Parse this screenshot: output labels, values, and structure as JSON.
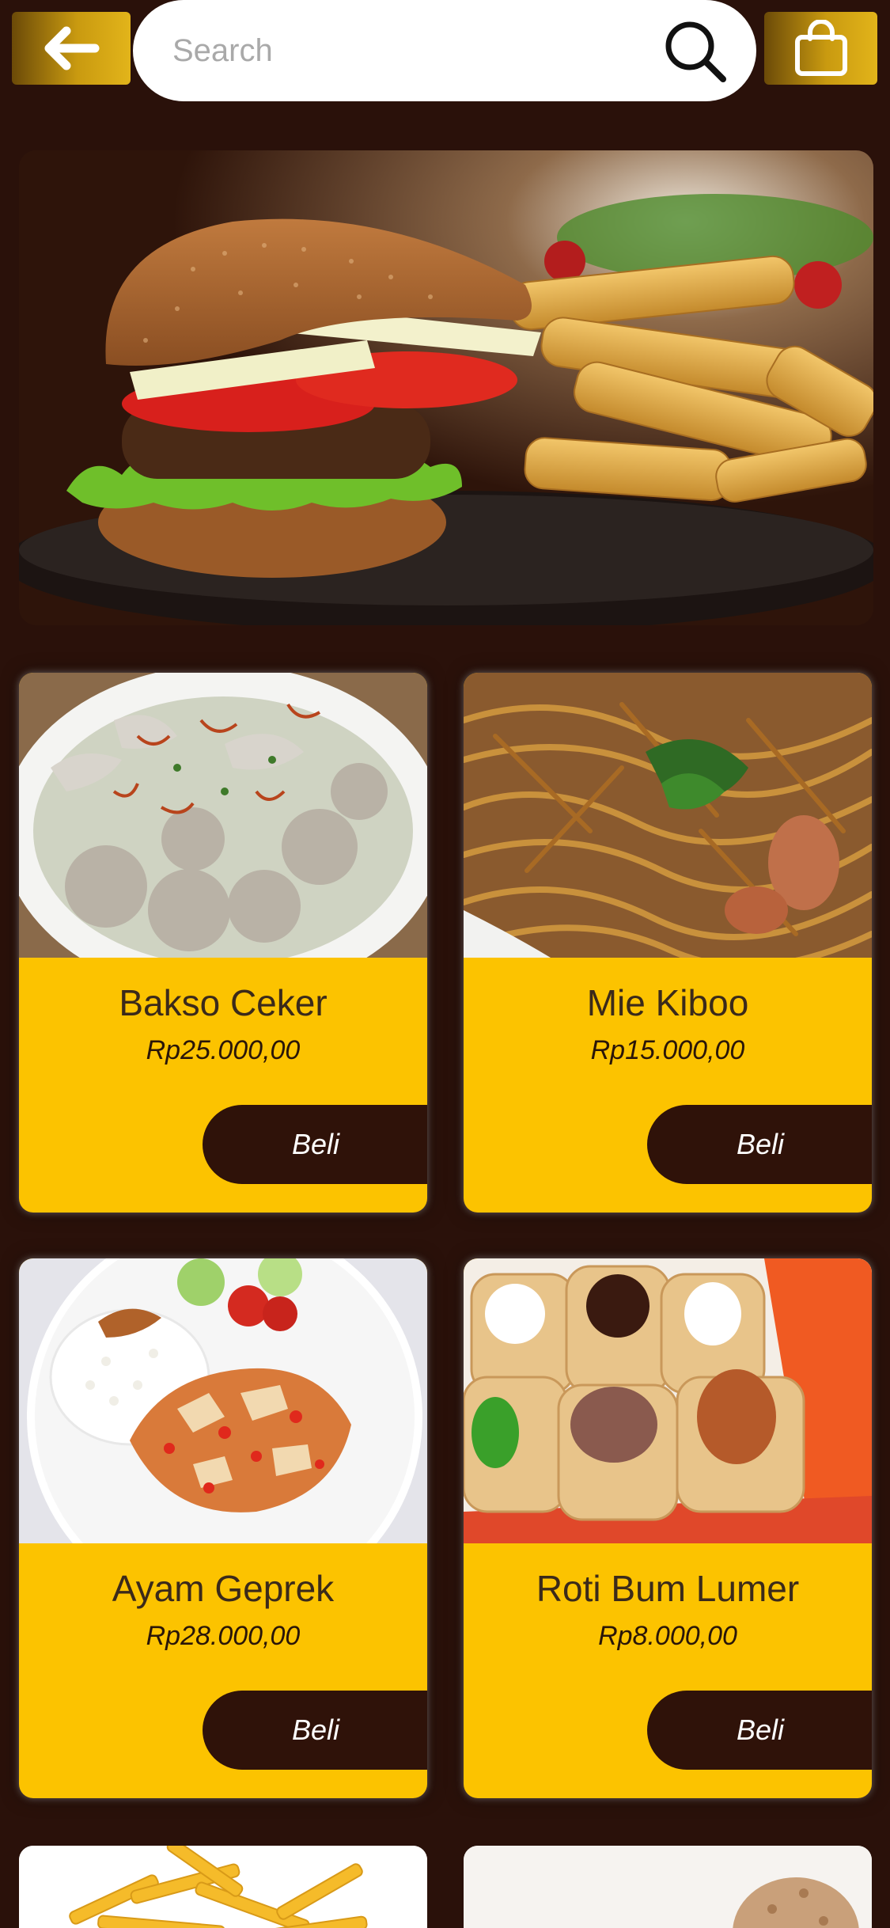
{
  "header": {
    "search_placeholder": "Search",
    "back_icon": "arrow-left-icon",
    "search_icon": "search-icon",
    "cart_icon": "shopping-bag-icon"
  },
  "banner": {
    "image": "burger-and-fries-photo"
  },
  "products": [
    {
      "name": "Bakso Ceker",
      "price": "Rp25.000,00",
      "buy_label": "Beli",
      "image": "bakso-ceker-photo"
    },
    {
      "name": "Mie Kiboo",
      "price": "Rp15.000,00",
      "buy_label": "Beli",
      "image": "mie-kiboo-photo"
    },
    {
      "name": "Ayam Geprek",
      "price": "Rp28.000,00",
      "buy_label": "Beli",
      "image": "ayam-geprek-photo"
    },
    {
      "name": "Roti Bum Lumer",
      "price": "Rp8.000,00",
      "buy_label": "Beli",
      "image": "roti-bum-lumer-photo"
    }
  ],
  "partial_products": [
    {
      "image": "french-fries-photo"
    },
    {
      "image": "ice-cream-photo"
    }
  ],
  "colors": {
    "background": "#2a110a",
    "card": "#fcc300",
    "button": "#2f1209",
    "accent_gold": "#c99a10"
  }
}
